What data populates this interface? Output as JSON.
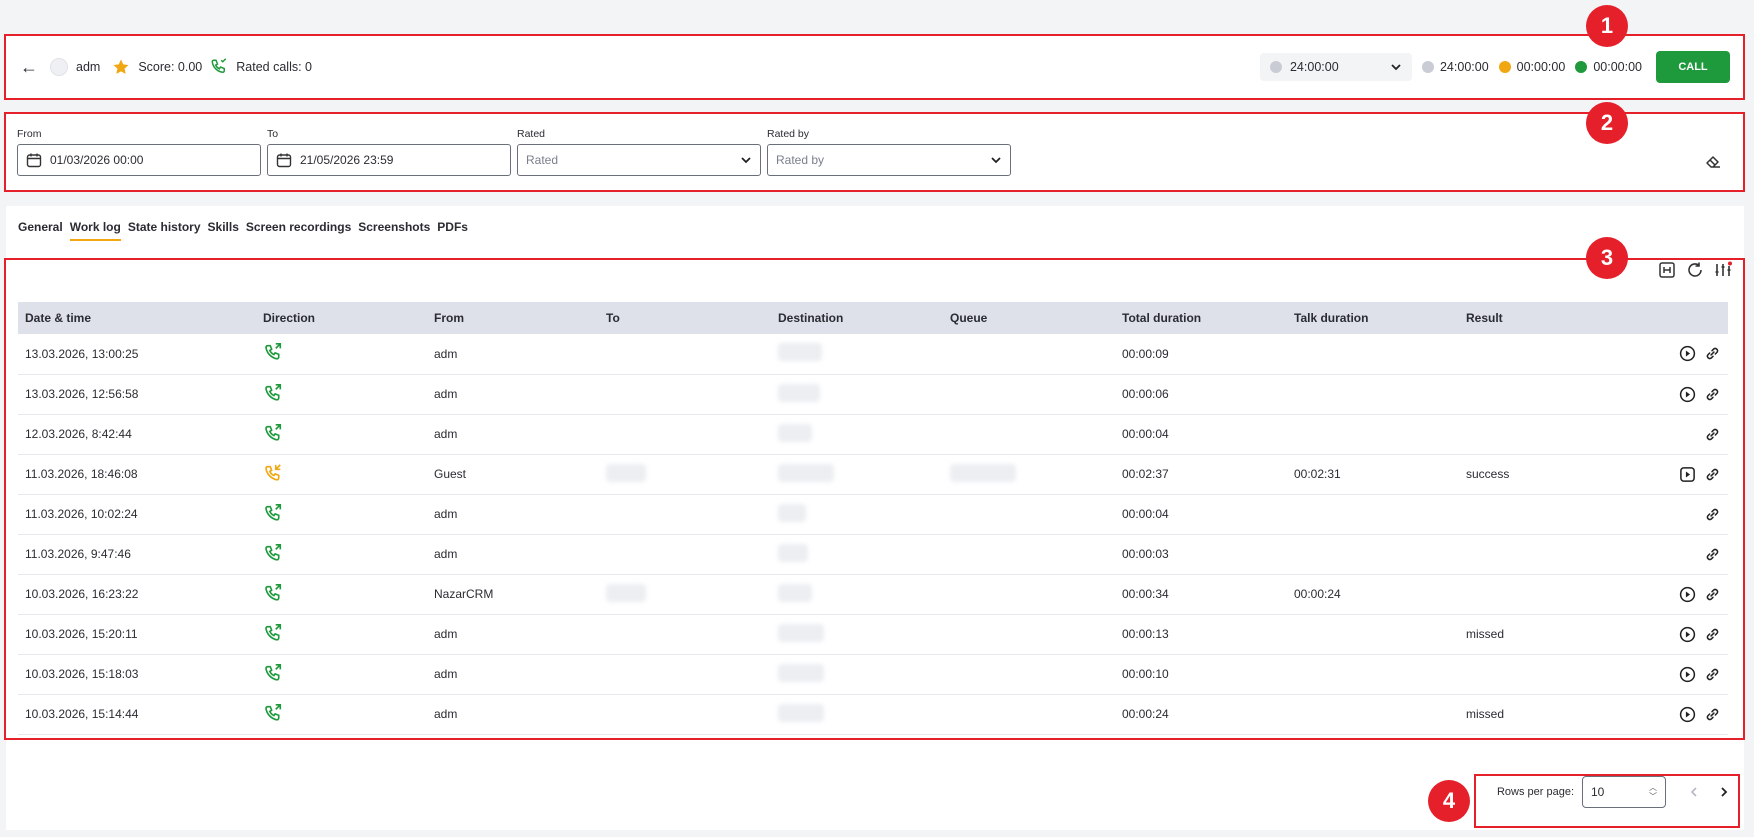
{
  "header": {
    "back_label": "←",
    "user": "adm",
    "score": "Score: 0.00",
    "rated_calls": "Rated calls: 0",
    "time_select": "24:00:00",
    "legend": [
      {
        "color": "#c9ccd4",
        "value": "24:00:00"
      },
      {
        "color": "#f0a712",
        "value": "00:00:00"
      },
      {
        "color": "#1e9a3c",
        "value": "00:00:00"
      }
    ],
    "call_label": "CALL"
  },
  "filters": {
    "from_label": "From",
    "from_value": "01/03/2026 00:00",
    "to_label": "To",
    "to_value": "21/05/2026 23:59",
    "rated_label": "Rated",
    "rated_placeholder": "Rated",
    "rated_by_label": "Rated by",
    "rated_by_placeholder": "Rated by"
  },
  "tabs": [
    "General",
    "Work log",
    "State history",
    "Skills",
    "Screen recordings",
    "Screenshots",
    "PDFs"
  ],
  "table": {
    "columns": [
      "Date & time",
      "Direction",
      "From",
      "To",
      "Destination",
      "Queue",
      "Total duration",
      "Talk duration",
      "Result"
    ],
    "rows": [
      {
        "date": "13.03.2026, 13:00:25",
        "dir": "out",
        "from": "adm",
        "total": "00:00:09",
        "talk": "",
        "result": "",
        "play": "circle"
      },
      {
        "date": "13.03.2026, 12:56:58",
        "dir": "out",
        "from": "adm",
        "total": "00:00:06",
        "talk": "",
        "result": "",
        "play": "circle"
      },
      {
        "date": "12.03.2026, 8:42:44",
        "dir": "out",
        "from": "adm",
        "total": "00:00:04",
        "talk": "",
        "result": "",
        "play": "none"
      },
      {
        "date": "11.03.2026, 18:46:08",
        "dir": "in",
        "from": "Guest",
        "total": "00:02:37",
        "talk": "00:02:31",
        "result": "success",
        "play": "square"
      },
      {
        "date": "11.03.2026, 10:02:24",
        "dir": "out",
        "from": "adm",
        "total": "00:00:04",
        "talk": "",
        "result": "",
        "play": "none"
      },
      {
        "date": "11.03.2026, 9:47:46",
        "dir": "out",
        "from": "adm",
        "total": "00:00:03",
        "talk": "",
        "result": "",
        "play": "none"
      },
      {
        "date": "10.03.2026, 16:23:22",
        "dir": "out",
        "from": "NazarCRM",
        "total": "00:00:34",
        "talk": "00:00:24",
        "result": "",
        "play": "circle"
      },
      {
        "date": "10.03.2026, 15:20:11",
        "dir": "out",
        "from": "adm",
        "total": "00:00:13",
        "talk": "",
        "result": "missed",
        "play": "circle"
      },
      {
        "date": "10.03.2026, 15:18:03",
        "dir": "out",
        "from": "adm",
        "total": "00:00:10",
        "talk": "",
        "result": "",
        "play": "circle"
      },
      {
        "date": "10.03.2026, 15:14:44",
        "dir": "out",
        "from": "adm",
        "total": "00:00:24",
        "talk": "",
        "result": "missed",
        "play": "circle"
      }
    ]
  },
  "pagination": {
    "rows_label": "Rows per page:",
    "rows_value": "10"
  },
  "badges": [
    "1",
    "2",
    "3",
    "4"
  ],
  "colors": {
    "accent": "#f0a712",
    "call_green": "#1e9a3c",
    "highlight": "#e5202a"
  }
}
